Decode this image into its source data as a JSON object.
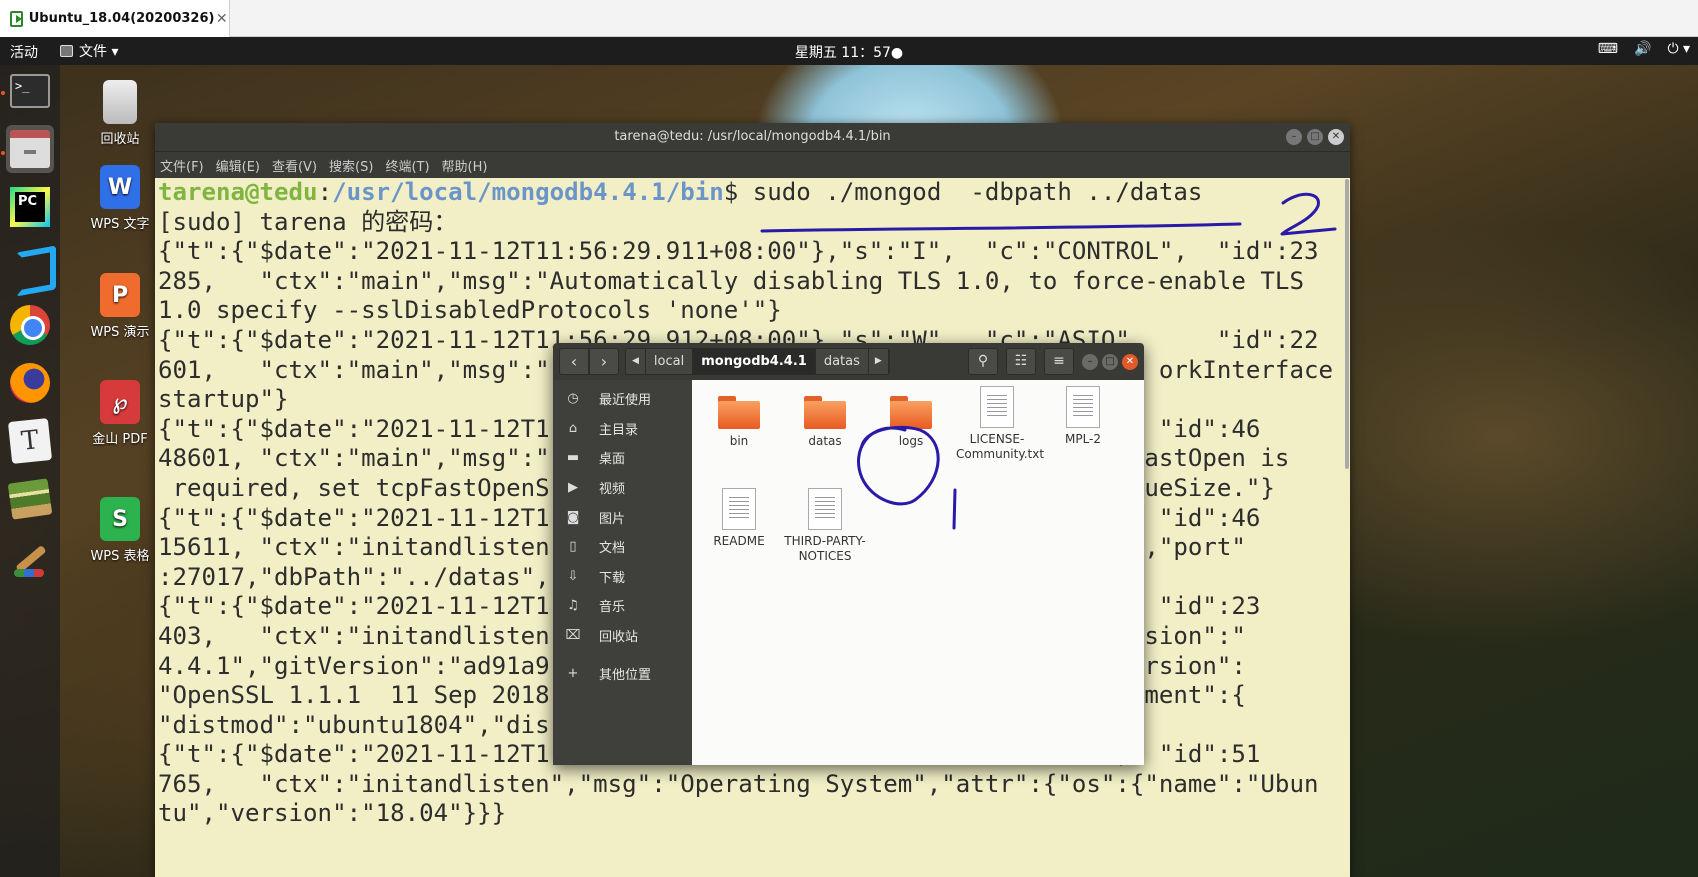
{
  "vm": {
    "tab_title": "Ubuntu_18.04(20200326)",
    "close_glyph": "✕"
  },
  "top_panel": {
    "activities": "活动",
    "app_menu": "文件 ▾",
    "clock": "星期五 11：57●",
    "tray": [
      "⌨",
      "🔊",
      "⏻ ▾"
    ]
  },
  "dock": [
    {
      "name": "terminal",
      "label": ">_"
    },
    {
      "name": "files"
    },
    {
      "name": "pycharm",
      "label": "PC"
    },
    {
      "name": "vscode"
    },
    {
      "name": "chrome"
    },
    {
      "name": "firefox"
    },
    {
      "name": "typora",
      "label": "T"
    },
    {
      "name": "books"
    },
    {
      "name": "paint"
    }
  ],
  "desktop_icons": [
    {
      "label": "回收站"
    },
    {
      "label": "WPS 文字",
      "glyph": "W"
    },
    {
      "label": "WPS 演示",
      "glyph": "P"
    },
    {
      "label": "金山 PDF",
      "glyph": "℘"
    },
    {
      "label": "WPS 表格",
      "glyph": "S"
    }
  ],
  "terminal": {
    "title": "tarena@tedu: /usr/local/mongodb4.4.1/bin",
    "menu": [
      "文件(F)",
      "编辑(E)",
      "查看(V)",
      "搜索(S)",
      "终端(T)",
      "帮助(H)"
    ],
    "prompt_user": "tarena@tedu",
    "prompt_sep": ":",
    "prompt_path": "/usr/local/mongodb4.4.1/bin",
    "prompt_end": "$ ",
    "command": "sudo ./mongod  -dbpath ../datas",
    "lines": [
      "[sudo] tarena 的密码：",
      "{\"t\":{\"$date\":\"2021-11-12T11:56:29.911+08:00\"},\"s\":\"I\",  \"c\":\"CONTROL\",  \"id\":23",
      "285,   \"ctx\":\"main\",\"msg\":\"Automatically disabling TLS 1.0, to force-enable TLS",
      "1.0 specify --sslDisabledProtocols 'none'\"}",
      "{\"t\":{\"$date\":\"2021-11-12T11:56:29.912+08:00\"},\"s\":\"W\",  \"c\":\"ASIO\",     \"id\":22",
      "601,   \"ctx\":\"main\",\"msg\":\"                                          orkInterface",
      "startup\"}",
      "{\"t\":{\"$date\":\"2021-11-12T1                                    RK\",  \"id\":46",
      "48601, \"ctx\":\"main\",\"msg\":\"                                      P FastOpen is",
      " required, set tcpFastOpenS                                     nQueueSize.\"}",
      "{\"t\":{\"$date\":\"2021-11-12T1                                    GE\",  \"id\":46",
      "15611, \"ctx\":\"initandlisten                                   :17434,\"port\"",
      ":27017,\"dbPath\":\"../datas\",",
      "{\"t\":{\"$date\":\"2021-11-12T1                                    OL\",  \"id\":23",
      "403,   \"ctx\":\"initandlisten                                   :{\"version\":\"",
      "4.4.1\",\"gitVersion\":\"ad91a9                                   nSSLVersion\":",
      "\"OpenSSL 1.1.1  11 Sep 2018                                   nvironment\":{",
      "\"distmod\":\"ubuntu1804\",\"dis                                   }}",
      "{\"t\":{\"$date\":\"2021-11-12T1                                    OL\",  \"id\":51",
      "765,   \"ctx\":\"initandlisten\",\"msg\":\"Operating System\",\"attr\":{\"os\":{\"name\":\"Ubun",
      "tu\",\"version\":\"18.04\"}}}"
    ]
  },
  "files": {
    "breadcrumbs": [
      "local",
      "mongodb4.4.1",
      "datas"
    ],
    "current": "mongodb4.4.1",
    "sidebar": [
      {
        "label": "最近使用",
        "icon": "clock-icon",
        "glyph": "◷"
      },
      {
        "label": "主目录",
        "icon": "home-icon",
        "glyph": "⌂"
      },
      {
        "label": "桌面",
        "icon": "folder-icon",
        "glyph": "▬"
      },
      {
        "label": "视频",
        "icon": "video-icon",
        "glyph": "▶"
      },
      {
        "label": "图片",
        "icon": "camera-icon",
        "glyph": "◙"
      },
      {
        "label": "文档",
        "icon": "document-icon",
        "glyph": "▯"
      },
      {
        "label": "下载",
        "icon": "download-icon",
        "glyph": "⇩"
      },
      {
        "label": "音乐",
        "icon": "music-icon",
        "glyph": "♫"
      },
      {
        "label": "回收站",
        "icon": "trash-icon",
        "glyph": "⌧"
      },
      {
        "label": "其他位置",
        "icon": "plus-icon",
        "glyph": "+"
      }
    ],
    "items": [
      {
        "name": "bin",
        "kind": "folder"
      },
      {
        "name": "datas",
        "kind": "folder"
      },
      {
        "name": "logs",
        "kind": "folder"
      },
      {
        "name": "LICENSE-Community.txt",
        "kind": "file"
      },
      {
        "name": "MPL-2",
        "kind": "file"
      },
      {
        "name": "README",
        "kind": "file"
      },
      {
        "name": "THIRD-PARTY-NOTICES",
        "kind": "file"
      }
    ]
  },
  "annotations": {
    "label_1": "1",
    "label_2": "2",
    "ink_color": "#2a1aa8"
  }
}
